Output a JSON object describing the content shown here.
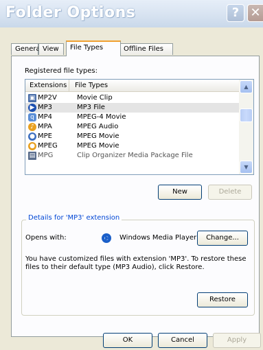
{
  "window": {
    "title": "Folder Options",
    "help_label": "?",
    "close_label": "✕"
  },
  "tabs": [
    {
      "label": "General"
    },
    {
      "label": "View"
    },
    {
      "label": "File Types"
    },
    {
      "label": "Offline Files"
    }
  ],
  "registered_label": "Registered file types:",
  "list": {
    "columns": [
      "Extensions",
      "File Types"
    ],
    "rows": [
      {
        "ext": "MP2V",
        "type": "Movie Clip",
        "icon": "video-clip-icon"
      },
      {
        "ext": "MP3",
        "type": "MP3 File",
        "icon": "media-player-icon",
        "selected": true
      },
      {
        "ext": "MP4",
        "type": "MPEG-4 Movie",
        "icon": "quicktime-icon"
      },
      {
        "ext": "MPA",
        "type": "MPEG Audio",
        "icon": "audio-icon"
      },
      {
        "ext": "MPE",
        "type": "MPEG Movie",
        "icon": "video-icon"
      },
      {
        "ext": "MPEG",
        "type": "MPEG Movie",
        "icon": "video-icon"
      },
      {
        "ext": "MPG",
        "type": "Clip Organizer Media Package File",
        "icon": "package-icon"
      }
    ]
  },
  "buttons": {
    "new": "New",
    "delete": "Delete",
    "change": "Change...",
    "restore": "Restore",
    "ok": "OK",
    "cancel": "Cancel",
    "apply": "Apply"
  },
  "details": {
    "title": "Details for 'MP3' extension",
    "opens_with_label": "Opens with:",
    "program": "Windows Media Player",
    "note_line1": "You have customized files with extension 'MP3'.  To restore these",
    "note_line2": "files to their default type (MP3 Audio), click Restore."
  },
  "colors": {
    "accent_tab": "#f0a030",
    "group_title": "#0046d5",
    "background": "#ece9d8"
  }
}
